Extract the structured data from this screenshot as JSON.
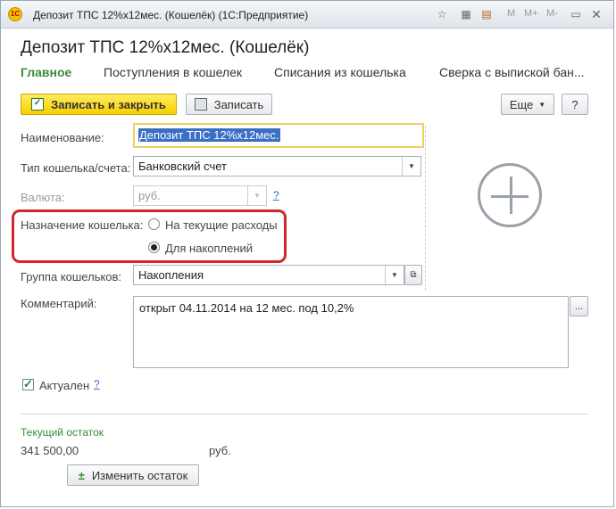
{
  "window": {
    "title": "Депозит ТПС 12%x12мес. (Кошелёк)  (1С:Предприятие)"
  },
  "titlebar": {
    "m_label": "M",
    "mplus_label": "M+",
    "mminus_label": "M-"
  },
  "page": {
    "title": "Депозит ТПС 12%x12мес. (Кошелёк)"
  },
  "tabs": [
    "Главное",
    "Поступления в кошелек",
    "Списания из кошелька",
    "Сверка с выпиской бан..."
  ],
  "toolbar": {
    "save_close": "Записать и закрыть",
    "save": "Записать",
    "more": "Еще",
    "help": "?"
  },
  "form": {
    "name_label": "Наименование:",
    "name_value": "Депозит ТПС 12%x12мес.",
    "type_label": "Тип кошелька/счета:",
    "type_value": "Банковский счет",
    "currency_label": "Валюта:",
    "currency_value": "руб.",
    "currency_help": "?",
    "purpose_label": "Назначение кошелька:",
    "purpose_option_1": "На текущие расходы",
    "purpose_option_2": "Для накоплений",
    "purpose_selected": "Для накоплений",
    "group_label": "Группа кошельков:",
    "group_value": "Накопления",
    "comment_label": "Комментарий:",
    "comment_value": "открыт 04.11.2014 на 12 мес. под 10,2%",
    "comment_btn": "...",
    "active_label": "Актуален",
    "active_checked": true,
    "active_help": "?"
  },
  "balance": {
    "title": "Текущий остаток",
    "amount": "341 500,00",
    "currency": "руб.",
    "change_button": "Изменить остаток"
  }
}
